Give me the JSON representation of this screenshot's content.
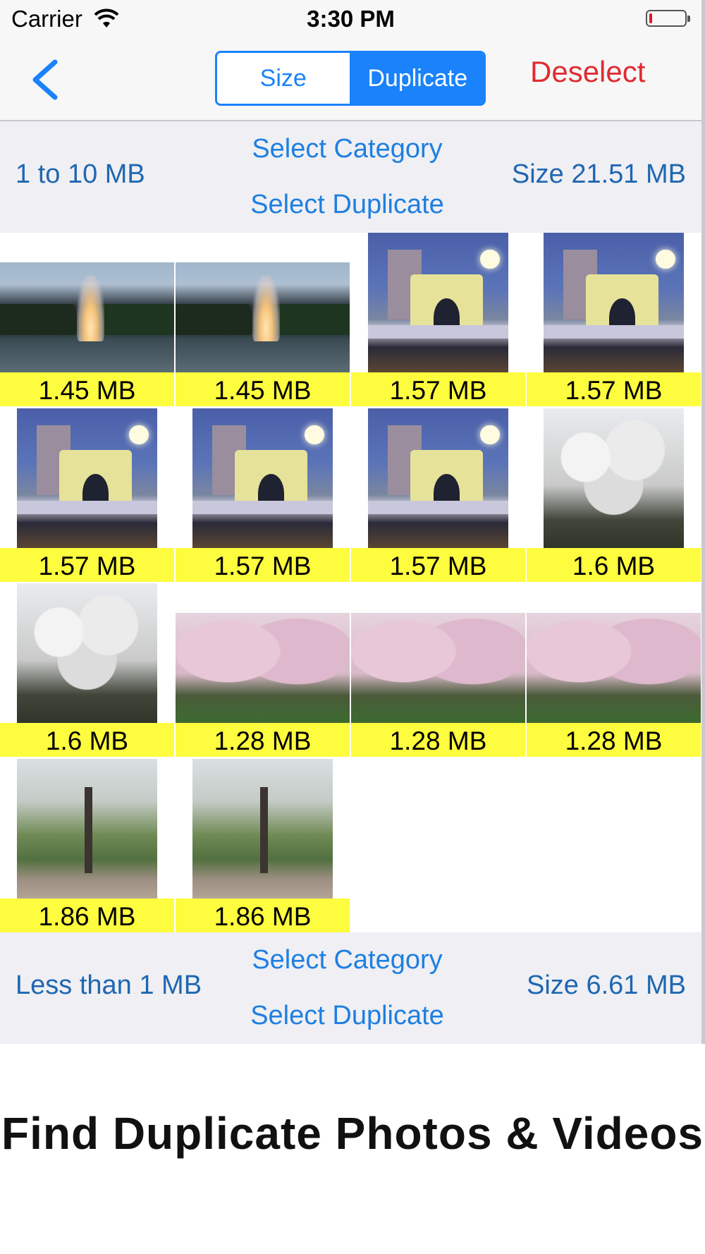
{
  "status_bar": {
    "carrier": "Carrier",
    "time": "3:30 PM",
    "battery_level": 0.08,
    "battery_color": "#e0162b"
  },
  "nav": {
    "back_icon": "chevron-left-icon",
    "segments": [
      "Size",
      "Duplicate"
    ],
    "selected_segment": "Duplicate",
    "deselect_label": "Deselect",
    "accent_color": "#1a82fb",
    "deselect_color": "#e02b31"
  },
  "sections": [
    {
      "range": "1 to 10 MB",
      "select_category": "Select Category",
      "select_duplicate": "Select Duplicate",
      "total": "Size 21.51 MB"
    },
    {
      "range": "Less than 1 MB",
      "select_category": "Select Category",
      "select_duplicate": "Select Duplicate",
      "total": "Size 6.61 MB"
    }
  ],
  "photos": [
    {
      "size": "1.45 MB",
      "subject": "fountain"
    },
    {
      "size": "1.45 MB",
      "subject": "fountain"
    },
    {
      "size": "1.57 MB",
      "subject": "arch"
    },
    {
      "size": "1.57 MB",
      "subject": "arch"
    },
    {
      "size": "1.57 MB",
      "subject": "arch"
    },
    {
      "size": "1.57 MB",
      "subject": "arch"
    },
    {
      "size": "1.57 MB",
      "subject": "arch"
    },
    {
      "size": "1.6 MB",
      "subject": "blossom"
    },
    {
      "size": "1.6 MB",
      "subject": "blossom"
    },
    {
      "size": "1.28 MB",
      "subject": "sakura"
    },
    {
      "size": "1.28 MB",
      "subject": "sakura"
    },
    {
      "size": "1.28 MB",
      "subject": "sakura"
    },
    {
      "size": "1.86 MB",
      "subject": "bare"
    },
    {
      "size": "1.86 MB",
      "subject": "bare"
    }
  ],
  "label_color": "#fdfc3e",
  "caption": "Find Duplicate Photos & Videos"
}
